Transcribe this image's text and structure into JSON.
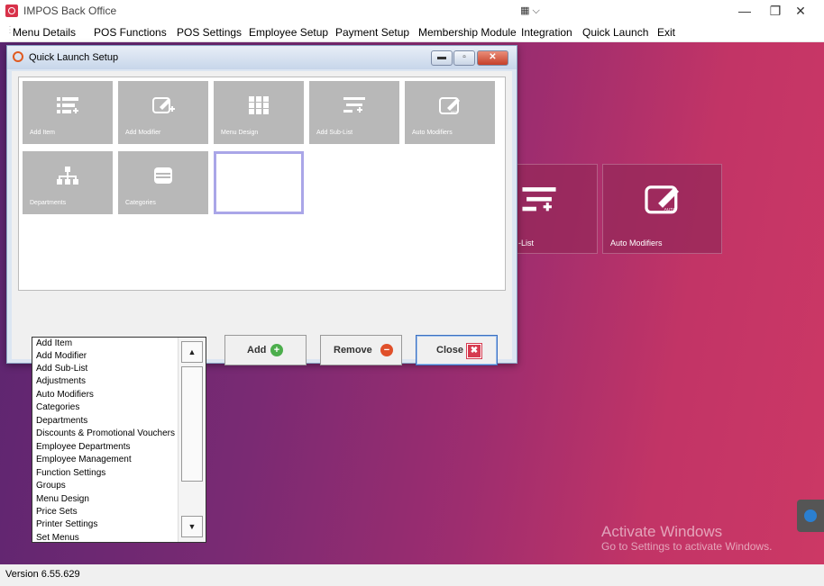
{
  "app": {
    "title": "IMPOS Back Office"
  },
  "menubar": {
    "items": [
      "Menu Details",
      "POS Functions",
      "POS Settings",
      "Employee Setup",
      "Payment Setup",
      "Membership Module",
      "Integration",
      "Quick Launch",
      "Exit"
    ]
  },
  "background": {
    "tiles": [
      "-List",
      "Auto Modifiers"
    ]
  },
  "watermark": {
    "line1": "Activate Windows",
    "line2": "Go to Settings to activate Windows."
  },
  "status": {
    "version": "Version 6.55.629"
  },
  "dialog": {
    "title": "Quick Launch Setup",
    "tiles": [
      "Add Item",
      "Add Modifier",
      "Menu Design",
      "Add Sub-List",
      "Auto Modifiers",
      "Departments",
      "Categories"
    ],
    "combo_value": "",
    "buttons": {
      "add": "Add",
      "remove": "Remove",
      "close": "Close"
    }
  },
  "dropdown": {
    "options": [
      "Add Item",
      "Add Modifier",
      "Add Sub-List",
      "Adjustments",
      "Auto Modifiers",
      "Categories",
      "Departments",
      "Discounts & Promotional Vouchers",
      "Employee Departments",
      "Employee Management",
      "Function Settings",
      "Groups",
      "Menu Design",
      "Price Sets",
      "Printer Settings",
      "Set Menus"
    ]
  },
  "colors": {
    "accent_blue": "#3d6fc0",
    "tile_gray": "#b8b8b8",
    "desktop_purple": "#7a2a73",
    "desktop_pink": "#cc3865"
  }
}
